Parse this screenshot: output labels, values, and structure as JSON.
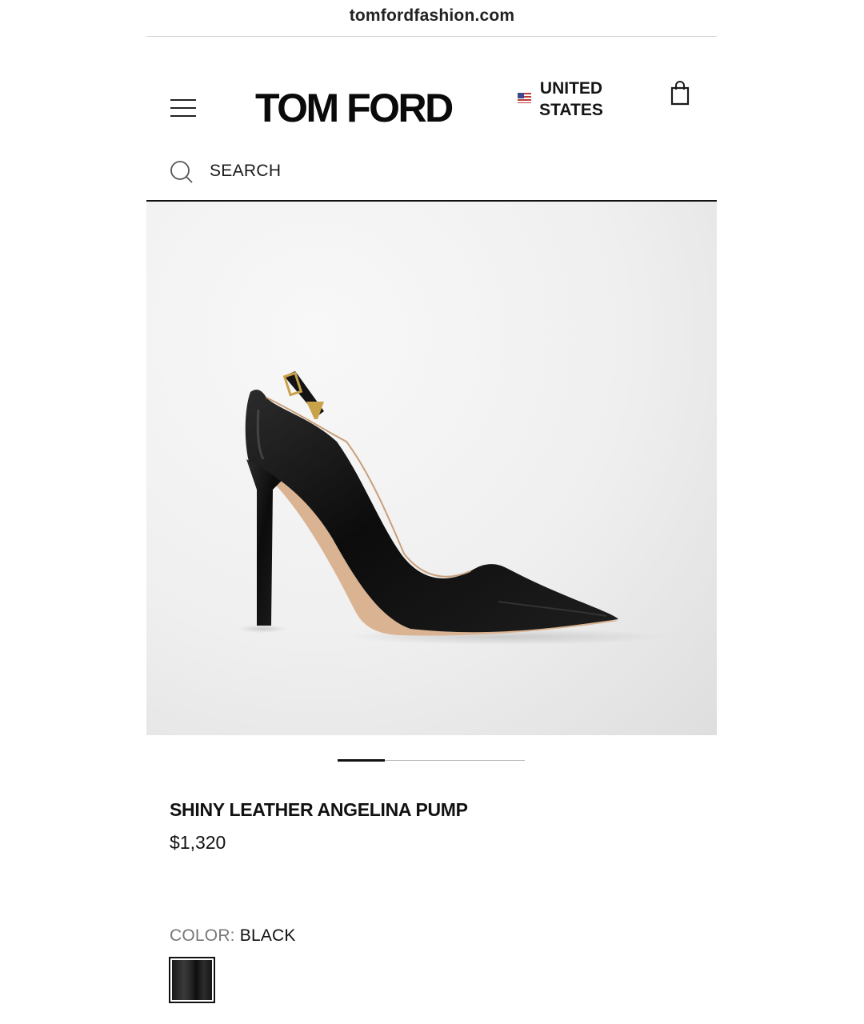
{
  "browser": {
    "url": "tomfordfashion.com"
  },
  "header": {
    "logo": "TOM FORD",
    "region_line1": "UNITED",
    "region_line2": "STATES",
    "region_flag": "us-flag-icon",
    "menu_icon": "hamburger-menu-icon",
    "cart_icon": "shopping-bag-icon"
  },
  "search": {
    "label": "SEARCH",
    "icon": "search-icon"
  },
  "gallery": {
    "current_slide": 1,
    "total_slides": 4,
    "image_alt": "black pointed-toe stiletto pump with gold T-buckle strap"
  },
  "product": {
    "name": "SHINY LEATHER ANGELINA PUMP",
    "price": "$1,320",
    "color_label": "COLOR:",
    "color_value": "BLACK"
  },
  "colors": {
    "text": "#111111",
    "muted": "#777777",
    "divider": "#d6d6d6",
    "image_bg": "#efefef"
  }
}
